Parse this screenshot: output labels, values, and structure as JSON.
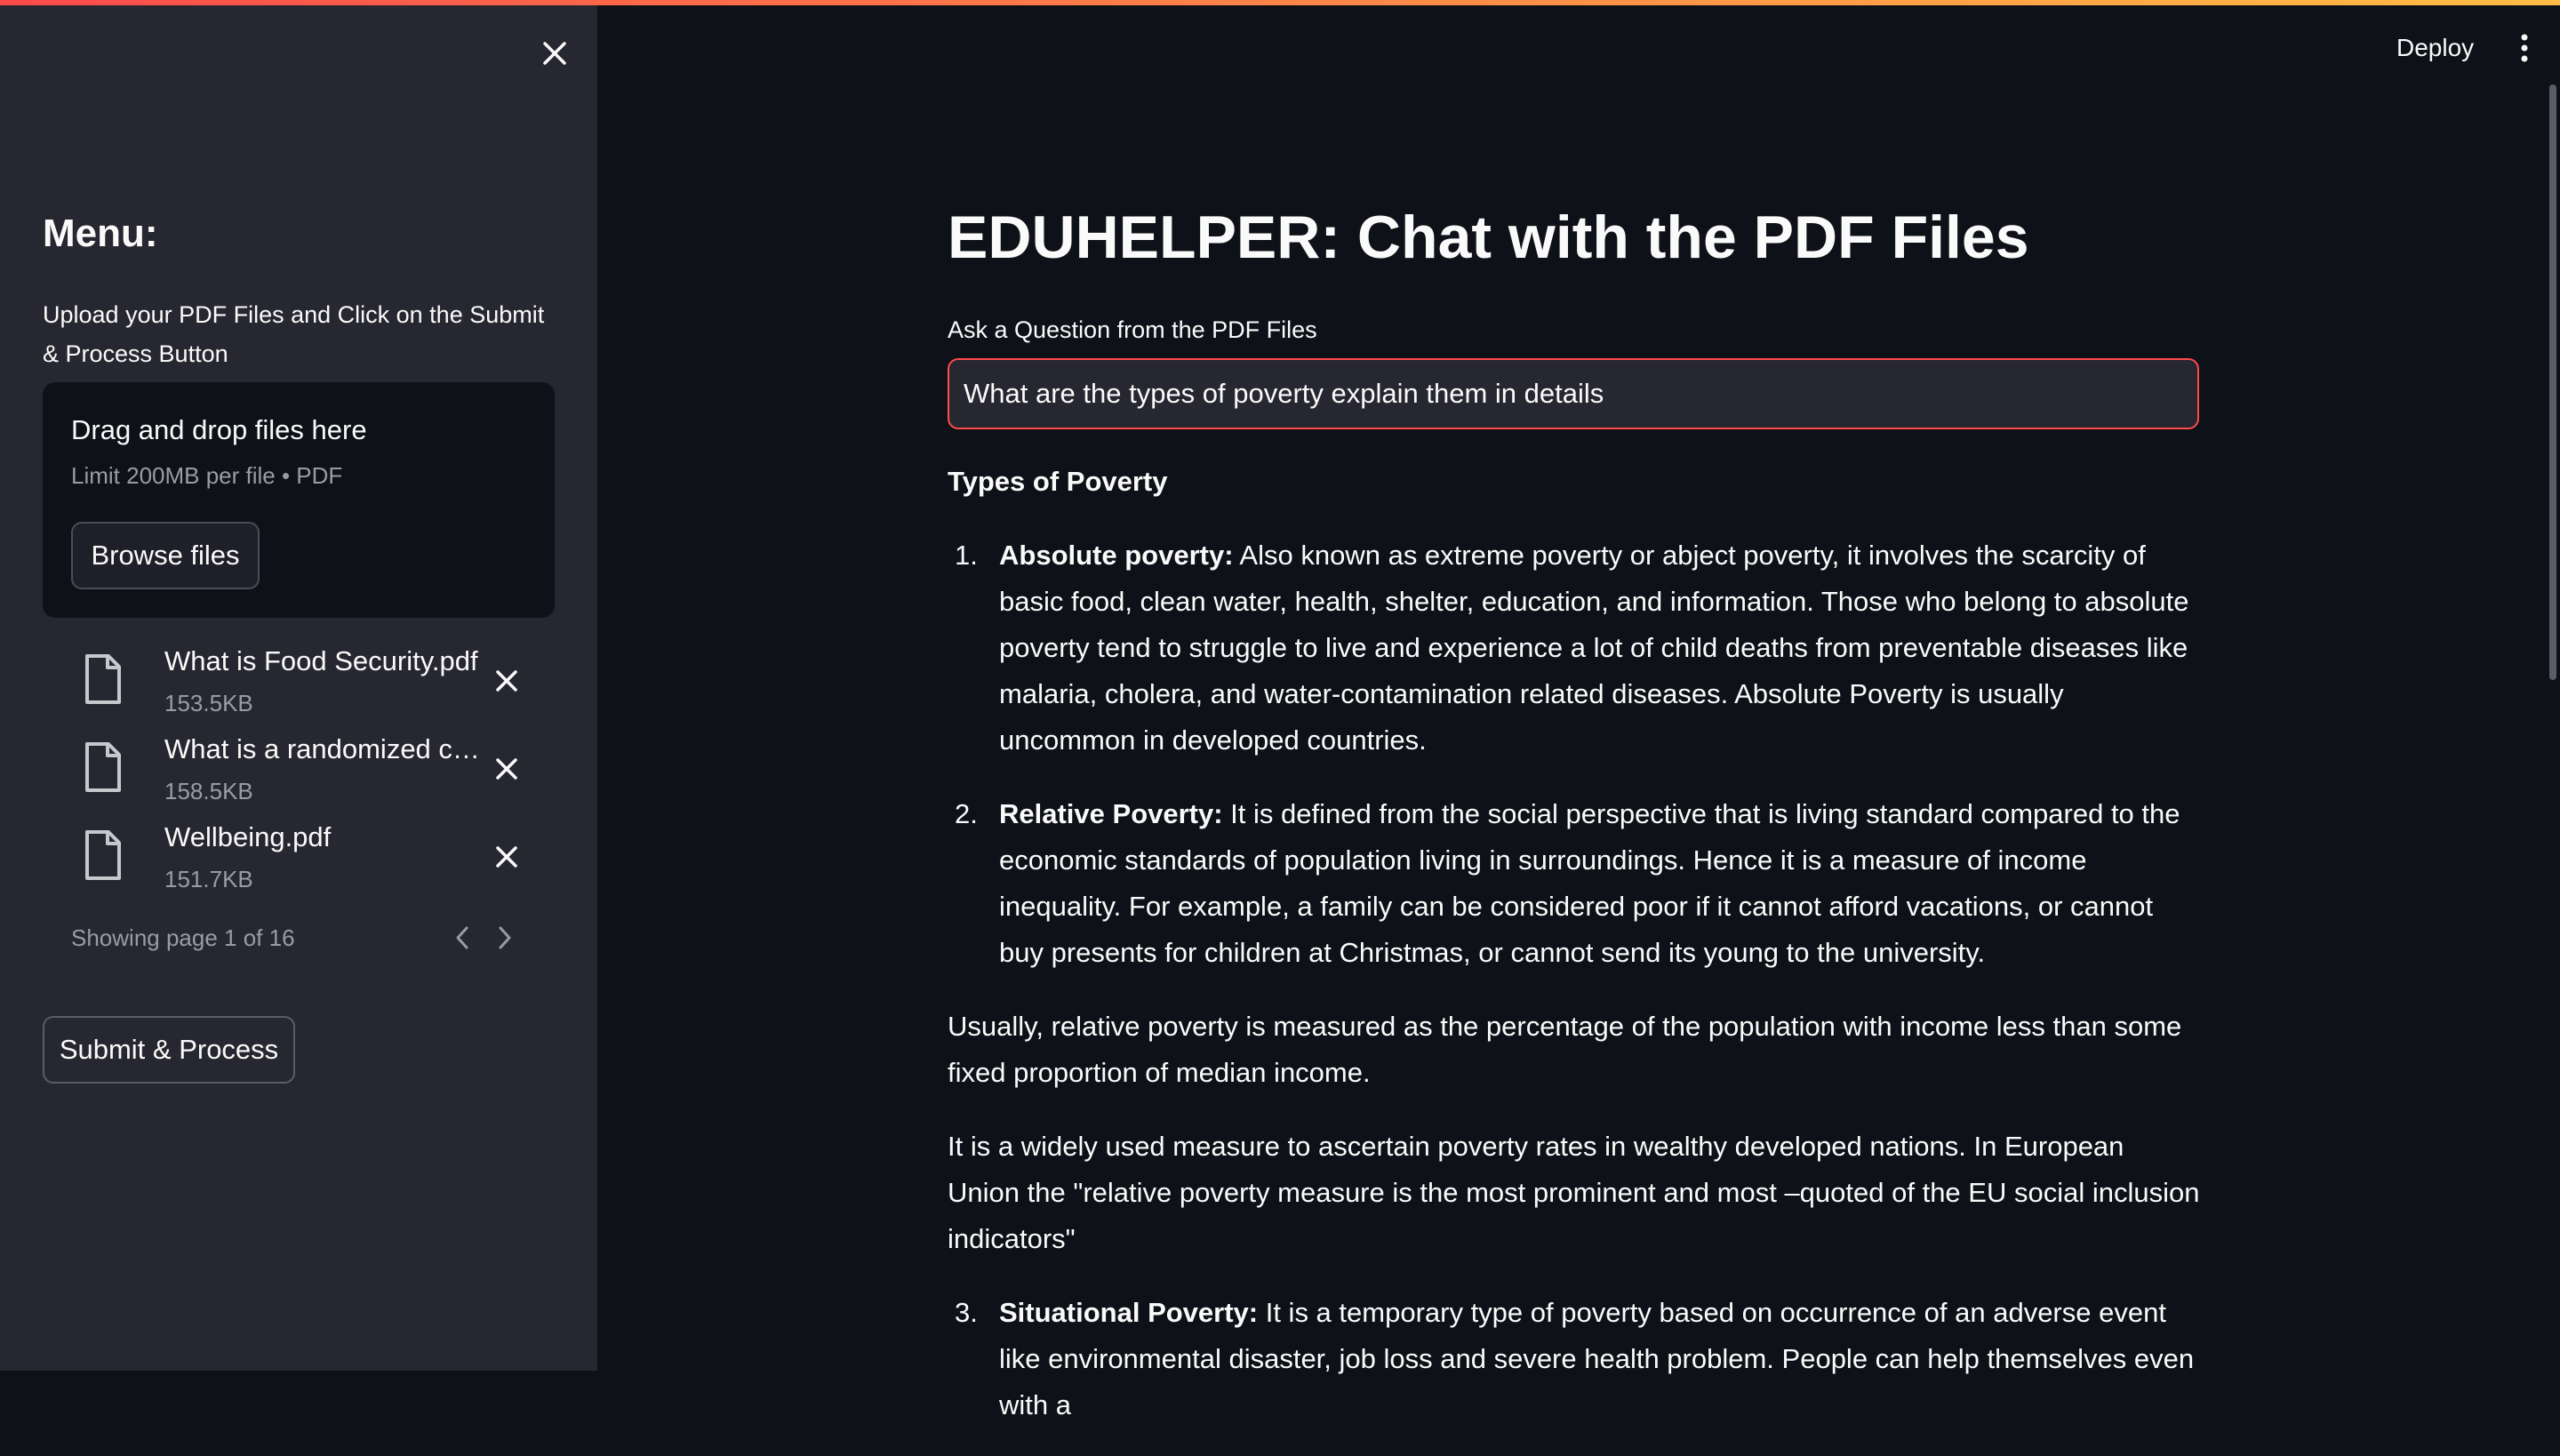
{
  "sidebar": {
    "menu_title": "Menu:",
    "upload_help": "Upload your PDF Files and Click on the Submit & Process Button",
    "dropzone": {
      "title": "Drag and drop files here",
      "limit": "Limit 200MB per file • PDF",
      "browse_label": "Browse files"
    },
    "files": [
      {
        "name": "What is Food Security.pdf",
        "size": "153.5KB"
      },
      {
        "name": "What is a randomized controlled trial.pdf",
        "size": "158.5KB"
      },
      {
        "name": "Wellbeing.pdf",
        "size": "151.7KB"
      }
    ],
    "pagination": "Showing page 1 of 16",
    "submit_label": "Submit & Process"
  },
  "header": {
    "deploy_label": "Deploy"
  },
  "main": {
    "title": "EDUHELPER: Chat with the PDF Files",
    "question_label": "Ask a Question from the PDF Files",
    "question_value": "What are the types of poverty explain them in details",
    "answer": {
      "heading": "Types of Poverty",
      "items": [
        {
          "num": "1.",
          "term": "Absolute poverty:",
          "text": " Also known as extreme poverty or abject poverty, it involves the scarcity of basic food, clean water, health, shelter, education, and information. Those who belong to absolute poverty tend to struggle to live and experience a lot of child deaths from preventable diseases like malaria, cholera, and water-contamination related diseases. Absolute Poverty is usually uncommon in developed countries."
        },
        {
          "num": "2.",
          "term": "Relative Poverty:",
          "text": " It is defined from the social perspective that is living standard compared to the economic standards of population living in surroundings. Hence it is a measure of income inequality. For example, a family can be considered poor if it cannot afford vacations, or cannot buy presents for children at Christmas, or cannot send its young to the university."
        }
      ],
      "paragraph_1": "Usually, relative poverty is measured as the percentage of the population with income less than some fixed proportion of median income.",
      "paragraph_2": "It is a widely used measure to ascertain poverty rates in wealthy developed nations. In European Union the \"relative poverty measure is the most prominent and most –quoted of the EU social inclusion indicators\"",
      "item_3": {
        "num": "3.",
        "term": "Situational Poverty:",
        "text": " It is a temporary type of poverty based on occurrence of an adverse event like environmental disaster, job loss and severe health problem. People can help themselves even with a"
      }
    }
  },
  "colors": {
    "accent": "#ff4b4b",
    "background": "#0e1117",
    "sidebar": "#262730",
    "text": "#fafafa",
    "muted": "#9a9ca4"
  }
}
